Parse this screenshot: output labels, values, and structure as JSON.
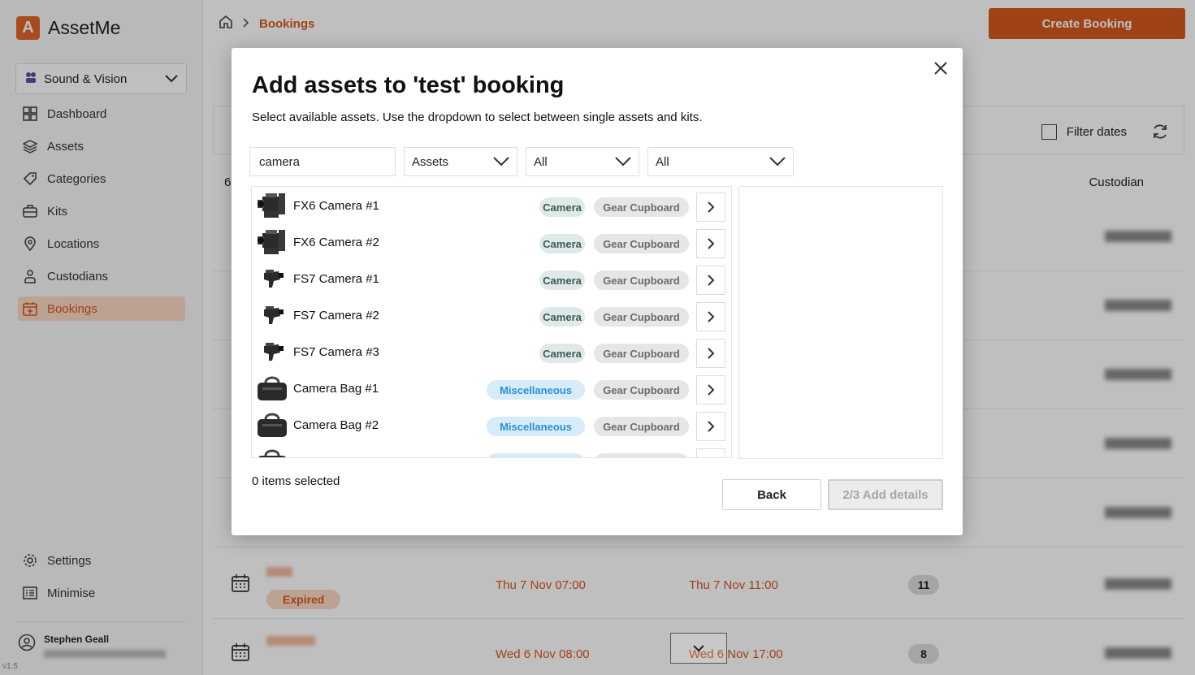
{
  "app": {
    "logo_letter": "A",
    "name": "AssetMe",
    "version": "v1.5"
  },
  "sidebar": {
    "org": "Sound & Vision",
    "items": [
      {
        "label": "Dashboard",
        "icon": "grid-icon"
      },
      {
        "label": "Assets",
        "icon": "layers-icon"
      },
      {
        "label": "Categories",
        "icon": "tag-icon"
      },
      {
        "label": "Kits",
        "icon": "briefcase-icon"
      },
      {
        "label": "Locations",
        "icon": "map-pin-icon"
      },
      {
        "label": "Custodians",
        "icon": "person-icon"
      },
      {
        "label": "Bookings",
        "icon": "calendar-icon",
        "active": true
      }
    ],
    "bottom": [
      {
        "label": "Settings",
        "icon": "gear-icon"
      },
      {
        "label": "Minimise",
        "icon": "minimise-icon"
      }
    ],
    "user_name": "Stephen Geall"
  },
  "header": {
    "breadcrumb": "Bookings",
    "create_label": "Create Booking"
  },
  "bookings_table": {
    "filter_dates_label": "Filter dates",
    "count_header_partial": "6",
    "custodian_header": "Custodian",
    "rows": [
      {
        "status": "Expired",
        "start": "Thu 7 Nov 07:00",
        "end": "Thu 7 Nov 11:00",
        "count": "11"
      },
      {
        "status": "",
        "start": "Wed 6 Nov 08:00",
        "end": "Wed 6 Nov 17:00",
        "count": "8"
      }
    ]
  },
  "modal": {
    "title": "Add assets to 'test' booking",
    "subtitle": "Select available assets. Use the dropdown to select between single assets and kits.",
    "search_value": "camera",
    "type_select": "Assets",
    "filter_1": "All",
    "filter_2": "All",
    "assets": [
      {
        "name": "FX6 Camera #1",
        "category": "Camera",
        "location": "Gear Cupboard",
        "thumb": "cinema-camera-icon"
      },
      {
        "name": "FX6 Camera #2",
        "category": "Camera",
        "location": "Gear Cupboard",
        "thumb": "cinema-camera-icon"
      },
      {
        "name": "FS7 Camera #1",
        "category": "Camera",
        "location": "Gear Cupboard",
        "thumb": "camcorder-icon"
      },
      {
        "name": "FS7 Camera #2",
        "category": "Camera",
        "location": "Gear Cupboard",
        "thumb": "camcorder-icon"
      },
      {
        "name": "FS7 Camera #3",
        "category": "Camera",
        "location": "Gear Cupboard",
        "thumb": "camcorder-icon"
      },
      {
        "name": "Camera Bag #1",
        "category": "Miscellaneous",
        "location": "Gear Cupboard",
        "thumb": "bag-icon"
      },
      {
        "name": "Camera Bag #2",
        "category": "Miscellaneous",
        "location": "Gear Cupboard",
        "thumb": "bag-icon"
      }
    ],
    "selected_count": "0 items selected",
    "back_label": "Back",
    "next_label": "2/3 Add details"
  },
  "colors": {
    "accent": "#d4581c",
    "accent_light": "#fbd9c5",
    "camera_tag": "#dfe9e8",
    "misc_tag": "#d7ecfb"
  }
}
